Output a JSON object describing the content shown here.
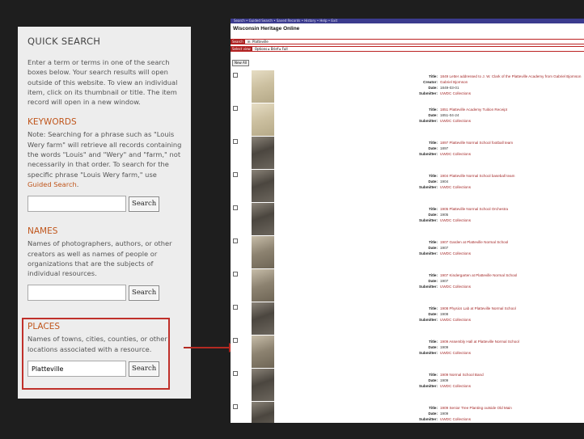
{
  "quick_search": {
    "title": "QUICK SEARCH",
    "intro": "Enter a term or terms in one of the search boxes below. Your search results will open outside of this website. To view an individual item, click on its thumbnail or title. The item record will open in a new window.",
    "keywords": {
      "heading": "KEYWORDS",
      "note": "Note: Searching for a phrase such as \"Louis Wery farm\" will retrieve all records containing the words \"Louis\" and \"Wery\" and \"farm,\" not necessarily in that order. To search for the specific phrase \"Louis Wery farm,\" use ",
      "link": "Guided Search",
      "note_end": ".",
      "value": "",
      "button": "Search"
    },
    "names": {
      "heading": "NAMES",
      "desc": "Names of photographers, authors, or other creators as well as names of people or organizations that are the subjects of individual resources.",
      "value": "",
      "button": "Search"
    },
    "places": {
      "heading": "PLACES",
      "desc": "Names of towns, cities, counties, or other locations associated with a resource.",
      "value": "Platteville",
      "button": "Search"
    }
  },
  "results": {
    "topbar": "Search • Guided Search • Saved Records • History • Help • Exit",
    "site_title": "Wisconsin Heritage Online",
    "search_label": "Search",
    "search_value": "in: Platteville",
    "select_label": "Select view",
    "select_value": "Options ▸ Brief ▸ Full",
    "new_button": "New All",
    "labels": {
      "title": "Title:",
      "creator": "Creator:",
      "date": "Date:",
      "submitter": "Submitter:"
    },
    "records": [
      {
        "title": "1849 Letter addressed to J. W. Clark of the Platteville Academy from Gabriel Bjornson",
        "creator": "Gabriel Bjornson",
        "date": "1849-03-01",
        "submitter": "UWDC Collections",
        "thumb": "doc"
      },
      {
        "title": "1851 Platteville Academy Tuition Receipt",
        "date": "1851-04-24",
        "submitter": "UWDC Collections",
        "thumb": "doc"
      },
      {
        "title": "1897 Platteville Normal School football team",
        "date": "1897",
        "submitter": "UWDC Collections",
        "thumb": "photo"
      },
      {
        "title": "1904 Platteville Normal School baseball team",
        "date": "1904",
        "submitter": "UWDC Collections",
        "thumb": "photo"
      },
      {
        "title": "1905 Platteville Normal School Orchestra",
        "date": "1905",
        "submitter": "UWDC Collections",
        "thumb": "photo"
      },
      {
        "title": "1907 Garden at Platteville Normal School",
        "date": "1907",
        "submitter": "UWDC Collections",
        "thumb": "sepia"
      },
      {
        "title": "1907 Kindergarten at Platteville Normal School",
        "date": "1907",
        "submitter": "UWDC Collections",
        "thumb": "sepia"
      },
      {
        "title": "1908 Physics Lab at Platteville Normal School",
        "date": "1908",
        "submitter": "UWDC Collections",
        "thumb": "photo"
      },
      {
        "title": "1909 Assembly Hall at Platteville Normal School",
        "date": "1909",
        "submitter": "UWDC Collections",
        "thumb": "sepia"
      },
      {
        "title": "1909 Normal School Band",
        "date": "1909",
        "submitter": "UWDC Collections",
        "thumb": "photo"
      },
      {
        "title": "1909 Senior Tree Planting outside Old Main",
        "date": "1909",
        "submitter": "UWDC Collections",
        "thumb": "photo"
      }
    ]
  },
  "colors": {
    "accent": "#c0561c",
    "highlight_box": "#c0302a",
    "arrow": "#b42a22",
    "link": "#a52a2a"
  }
}
